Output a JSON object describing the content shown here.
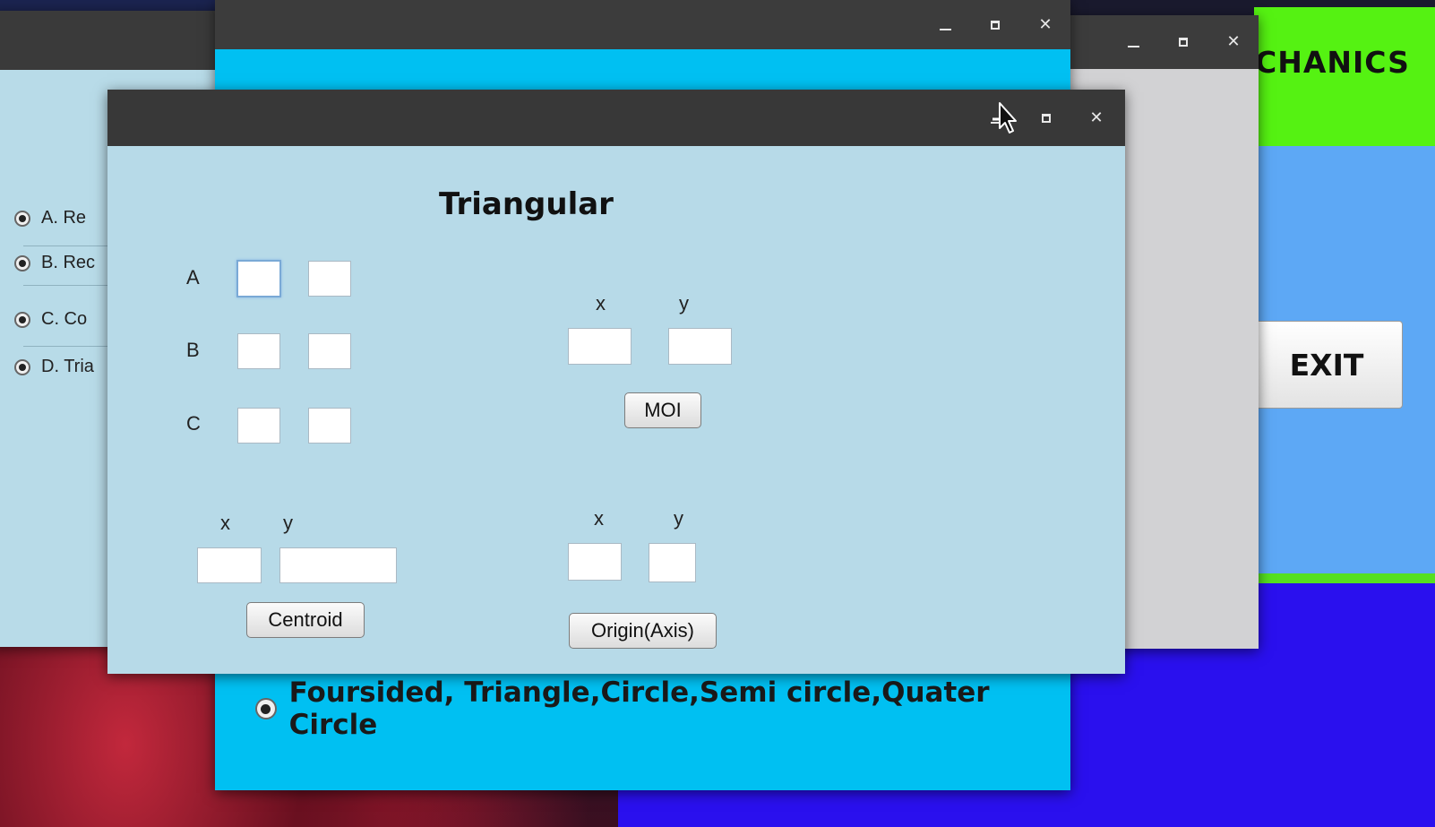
{
  "background_windows": {
    "left_window": {
      "options": [
        "A.  Re",
        "B. Rec",
        "C.  Co",
        "D.  Tria"
      ]
    },
    "center_window": {
      "option_label": "Foursided, Triangle,Circle,Semi circle,Quater Circle"
    },
    "mechanics_app": {
      "title": "CHANICS",
      "exit_label": "EXIT"
    }
  },
  "dialog": {
    "title": "Triangular",
    "vertex_labels": {
      "a": "A",
      "b": "B",
      "c": "C"
    },
    "vertex_inputs": [
      [
        "",
        ""
      ],
      [
        "",
        ""
      ],
      [
        "",
        ""
      ]
    ],
    "centroid": {
      "x_label": "x",
      "y_label": "y",
      "x_value": "",
      "y_value": "",
      "button_label": "Centroid"
    },
    "moi": {
      "x_label": "x",
      "y_label": "y",
      "x_value": "",
      "y_value": "",
      "button_label": "MOI"
    },
    "origin": {
      "x_label": "x",
      "y_label": "y",
      "x_value": "",
      "y_value": "",
      "button_label": "Origin(Axis)"
    }
  },
  "colors": {
    "dialog_bg": "#b7dae8",
    "titlebar": "#383838",
    "cyan_window": "#00c0f2",
    "mechanics_green": "#55f212",
    "mechanics_blue": "#5da8f5",
    "desktop_blue": "#2a10ee"
  }
}
